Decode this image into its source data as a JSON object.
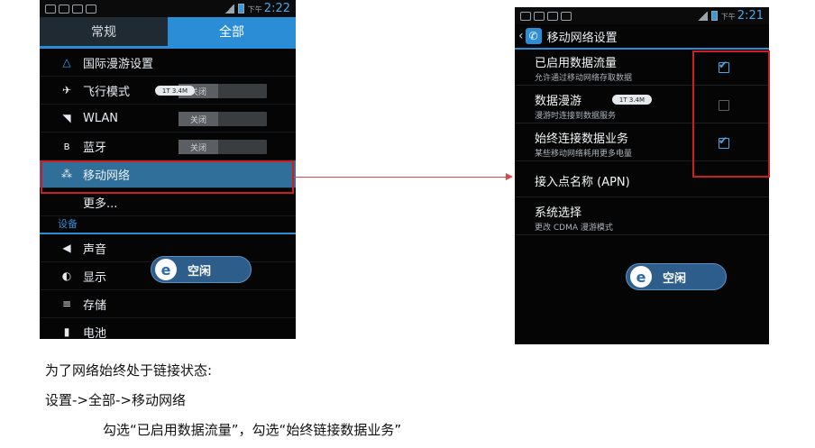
{
  "left_phone": {
    "status_time": "2:22",
    "status_ampm": "下午",
    "tabs": [
      {
        "label": "常规"
      },
      {
        "label": "全部"
      }
    ],
    "menu": [
      {
        "icon": "triangle-icon",
        "label": "国际漫游设置"
      },
      {
        "icon": "airplane-icon",
        "label": "飞行模式",
        "toggle": "关闭",
        "speed": "1T 3.4M"
      },
      {
        "icon": "wifi-icon",
        "label": "WLAN",
        "toggle": "关闭"
      },
      {
        "icon": "bluetooth-icon",
        "label": "蓝牙",
        "toggle": "关闭"
      },
      {
        "icon": "mobile-network-icon",
        "label": "移动网络"
      },
      {
        "icon": "",
        "label": "更多..."
      }
    ],
    "section_header": "设备",
    "device_menu": [
      {
        "icon": "speaker-icon",
        "label": "声音"
      },
      {
        "icon": "brightness-icon",
        "label": "显示"
      },
      {
        "icon": "storage-icon",
        "label": "存储"
      },
      {
        "icon": "battery-icon",
        "label": "电池"
      }
    ],
    "idle_label": "空闲"
  },
  "right_phone": {
    "status_time": "2:21",
    "status_ampm": "下午",
    "title": "移动网络设置",
    "settings": [
      {
        "title": "已启用数据流量",
        "subtitle": "允许通过移动网络存取数据",
        "checked": true
      },
      {
        "title": "数据漫游",
        "subtitle": "漫游时连接到数据服务",
        "checked": false,
        "speed": "1T 3.4M"
      },
      {
        "title": "始终连接数据业务",
        "subtitle": "某些移动网络耗用更多电量",
        "checked": true
      },
      {
        "title": "接入点名称 (APN)",
        "subtitle": ""
      },
      {
        "title": "系统选择",
        "subtitle": "更改 CDMA 漫游模式"
      }
    ],
    "idle_label": "空闲"
  },
  "annotation_color": "#cc1f1f",
  "captions": [
    "为了网络始终处于链接状态:",
    "设置->全部->移动网络",
    "勾选“已启用数据流量”，勾选“始终链接数据业务”"
  ]
}
